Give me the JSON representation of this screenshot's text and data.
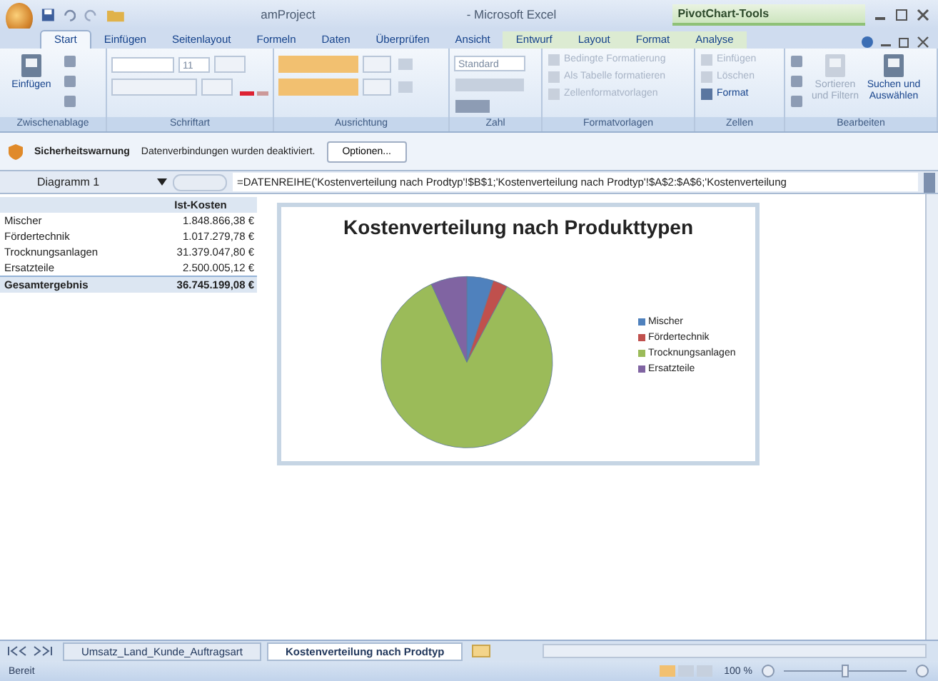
{
  "window": {
    "title": "amProject",
    "app": "- Microsoft Excel",
    "context_title": "PivotChart-Tools"
  },
  "tabs": [
    {
      "label": "Start",
      "selected": true,
      "context": false
    },
    {
      "label": "Einfügen",
      "selected": false,
      "context": false
    },
    {
      "label": "Seitenlayout",
      "selected": false,
      "context": false
    },
    {
      "label": "Formeln",
      "selected": false,
      "context": false
    },
    {
      "label": "Daten",
      "selected": false,
      "context": false
    },
    {
      "label": "Überprüfen",
      "selected": false,
      "context": false
    },
    {
      "label": "Ansicht",
      "selected": false,
      "context": false
    },
    {
      "label": "Entwurf",
      "selected": false,
      "context": true
    },
    {
      "label": "Layout",
      "selected": false,
      "context": true
    },
    {
      "label": "Format",
      "selected": false,
      "context": true
    },
    {
      "label": "Analyse",
      "selected": false,
      "context": true
    }
  ],
  "ribbon": [
    {
      "label": "Zwischenablage",
      "commands": [
        {
          "kind": "big",
          "label": "Einfügen",
          "disabled": false
        },
        {
          "kind": "icons"
        }
      ]
    },
    {
      "label": "Schriftart",
      "commands": [
        {
          "kind": "font",
          "value": "11"
        }
      ]
    },
    {
      "label": "Ausrichtung",
      "commands": [
        {
          "kind": "align"
        }
      ]
    },
    {
      "label": "Zahl",
      "commands": [
        {
          "kind": "number",
          "value": "Standard"
        }
      ]
    },
    {
      "label": "Formatvorlagen",
      "commands": [
        {
          "kind": "small",
          "label": "Bedingte Formatierung",
          "disabled": true
        },
        {
          "kind": "small",
          "label": "Als Tabelle formatieren",
          "disabled": true
        },
        {
          "kind": "small",
          "label": "Zellenformatvorlagen",
          "disabled": true
        }
      ]
    },
    {
      "label": "Zellen",
      "commands": [
        {
          "kind": "small",
          "label": "Einfügen",
          "disabled": true
        },
        {
          "kind": "small",
          "label": "Löschen",
          "disabled": true
        },
        {
          "kind": "small",
          "label": "Format",
          "disabled": false
        }
      ]
    },
    {
      "label": "Bearbeiten",
      "commands": [
        {
          "kind": "icons"
        },
        {
          "kind": "big",
          "label": "Sortieren und Filtern",
          "disabled": true
        },
        {
          "kind": "big",
          "label": "Suchen und Auswählen",
          "disabled": false
        }
      ]
    }
  ],
  "security_bar": {
    "title": "Sicherheitswarnung",
    "message": "Datenverbindungen wurden deaktiviert.",
    "button": "Optionen..."
  },
  "formula_bar": {
    "name_box": "Diagramm 1",
    "formula": "=DATENREIHE('Kostenverteilung nach Prodtyp'!$B$1;'Kostenverteilung nach Prodtyp'!$A$2:$A$6;'Kostenverteilung"
  },
  "pivot_table": {
    "header": "Ist-Kosten",
    "rows": [
      {
        "label": "Mischer",
        "value": "1.848.866,38 €"
      },
      {
        "label": "Fördertechnik",
        "value": "1.017.279,78 €"
      },
      {
        "label": "Trocknungsanlagen",
        "value": "31.379.047,80 €"
      },
      {
        "label": "Ersatzteile",
        "value": "2.500.005,12 €"
      }
    ],
    "total": {
      "label": "Gesamtergebnis",
      "value": "36.745.199,08 €"
    }
  },
  "chart": {
    "chart_data": {
      "type": "pie",
      "title": "Kostenverteilung nach Produkttypen",
      "legend": "right",
      "categories": [
        "Mischer",
        "Fördertechnik",
        "Trocknungsanlagen",
        "Ersatzteile"
      ],
      "values": [
        5.03,
        2.77,
        85.4,
        6.8
      ],
      "colors": [
        "#4f81bd",
        "#c0504d",
        "#9bbb59",
        "#8064a2"
      ]
    }
  },
  "sheet_tabs": [
    {
      "label": "Umsatz_Land_Kunde_Auftragsart",
      "selected": false
    },
    {
      "label": "Kostenverteilung nach Prodtyp",
      "selected": true
    }
  ],
  "status_bar": {
    "status": "Bereit",
    "zoom": "100 %",
    "zoom_slider": {
      "level": 0.5
    }
  }
}
